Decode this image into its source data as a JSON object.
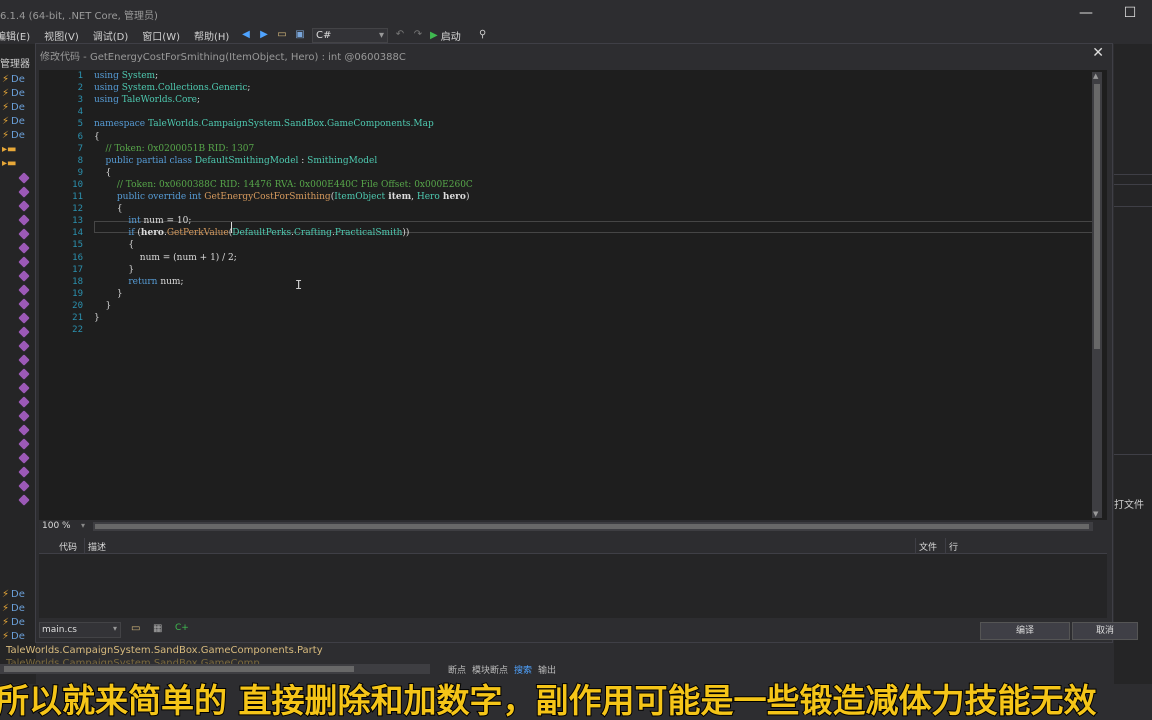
{
  "window": {
    "title": "6.1.4 (64-bit, .NET Core, 管理员)",
    "controls": [
      "—",
      "☐"
    ]
  },
  "menubar": {
    "items": [
      "编辑(E)",
      "视图(V)",
      "调试(D)",
      "窗口(W)",
      "帮助(H)"
    ]
  },
  "toolbar": {
    "language": "C#",
    "start_label": "启动"
  },
  "tree": {
    "header": "管理器",
    "item_label": "De",
    "nodes": [
      "De",
      "De",
      "De",
      "De",
      "De"
    ],
    "bottom_nodes": [
      "De",
      "De",
      "De",
      "De"
    ]
  },
  "right_panel": {
    "label": "打文件"
  },
  "status": {
    "path": "TaleWorlds.CampaignSystem.SandBox.GameComponents.Party",
    "path2": "TaleWorlds.CampaignSystem.SandBox.GameComp..."
  },
  "bottom_tabs": [
    "断点",
    "模块断点",
    "搜索",
    "输出"
  ],
  "dialog": {
    "title": "修改代码 - GetEnergyCostForSmithing(ItemObject, Hero) : int @0600388C",
    "zoom": "100 %",
    "error_list": {
      "columns": [
        "代码",
        "描述",
        "文件",
        "行"
      ]
    },
    "file": "main.cs",
    "compile_label": "编译",
    "cancel_label": "取消"
  },
  "code": {
    "line_numbers": [
      "1",
      "2",
      "3",
      "4",
      "5",
      "6",
      "7",
      "8",
      "9",
      "10",
      "11",
      "12",
      "13",
      "14",
      "15",
      "16",
      "17",
      "18",
      "19",
      "20",
      "21",
      "22"
    ],
    "lines": [
      [
        [
          "kw",
          "using "
        ],
        [
          "ty",
          "System"
        ],
        [
          "",
          "; "
        ]
      ],
      [
        [
          "kw",
          "using "
        ],
        [
          "ty",
          "System.Collections.Generic"
        ],
        [
          "",
          ";"
        ]
      ],
      [
        [
          "kw",
          "using "
        ],
        [
          "ty",
          "TaleWorlds.Core"
        ],
        [
          "",
          ";"
        ]
      ],
      [],
      [
        [
          "kw",
          "namespace "
        ],
        [
          "ty",
          "TaleWorlds.CampaignSystem.SandBox.GameComponents.Map"
        ]
      ],
      [
        [
          "",
          "{"
        ]
      ],
      [
        [
          "cm",
          "    // Token: 0x0200051B RID: 1307"
        ]
      ],
      [
        [
          "kw",
          "    public partial class "
        ],
        [
          "ty",
          "DefaultSmithingModel"
        ],
        [
          "",
          " : "
        ],
        [
          "ty",
          "SmithingModel"
        ]
      ],
      [
        [
          "",
          "    {"
        ]
      ],
      [
        [
          "cm",
          "        // Token: 0x0600388C RID: 14476 RVA: 0x000E440C File Offset: 0x000E260C"
        ]
      ],
      [
        [
          "kw",
          "        public override int "
        ],
        [
          "mt",
          "GetEnergyCostForSmithing"
        ],
        [
          "",
          "("
        ],
        [
          "ty",
          "ItemObject"
        ],
        [
          "pm",
          " item"
        ],
        [
          "",
          ", "
        ],
        [
          "ty",
          "Hero"
        ],
        [
          "pm",
          " hero"
        ],
        [
          "",
          ")"
        ]
      ],
      [
        [
          "",
          "        {"
        ]
      ],
      [
        [
          "kw",
          "            int "
        ],
        [
          "",
          "num = 10;"
        ]
      ],
      [
        [
          "kw",
          "            if "
        ],
        [
          "",
          "("
        ],
        [
          "pm",
          "hero"
        ],
        [
          "",
          "."
        ],
        [
          "mt",
          "GetPerkValue"
        ],
        [
          "",
          "("
        ],
        [
          "ty",
          "DefaultPerks"
        ],
        [
          "",
          "."
        ],
        [
          "ty",
          "Crafting"
        ],
        [
          "",
          "."
        ],
        [
          "ty",
          "PracticalSmith"
        ],
        [
          "",
          "))"
        ]
      ],
      [
        [
          "",
          "            {"
        ]
      ],
      [
        [
          "",
          "                num = (num + 1) / 2;"
        ]
      ],
      [
        [
          "",
          "            }"
        ]
      ],
      [
        [
          "kw",
          "            return "
        ],
        [
          "",
          "num;"
        ]
      ],
      [
        [
          "",
          "        }"
        ]
      ],
      [
        [
          "",
          "    }"
        ]
      ],
      [
        [
          "",
          "}"
        ]
      ],
      []
    ]
  },
  "subtitle": "所以就来简单的 直接删除和加数字，副作用可能是一些锻造减体力技能无效"
}
